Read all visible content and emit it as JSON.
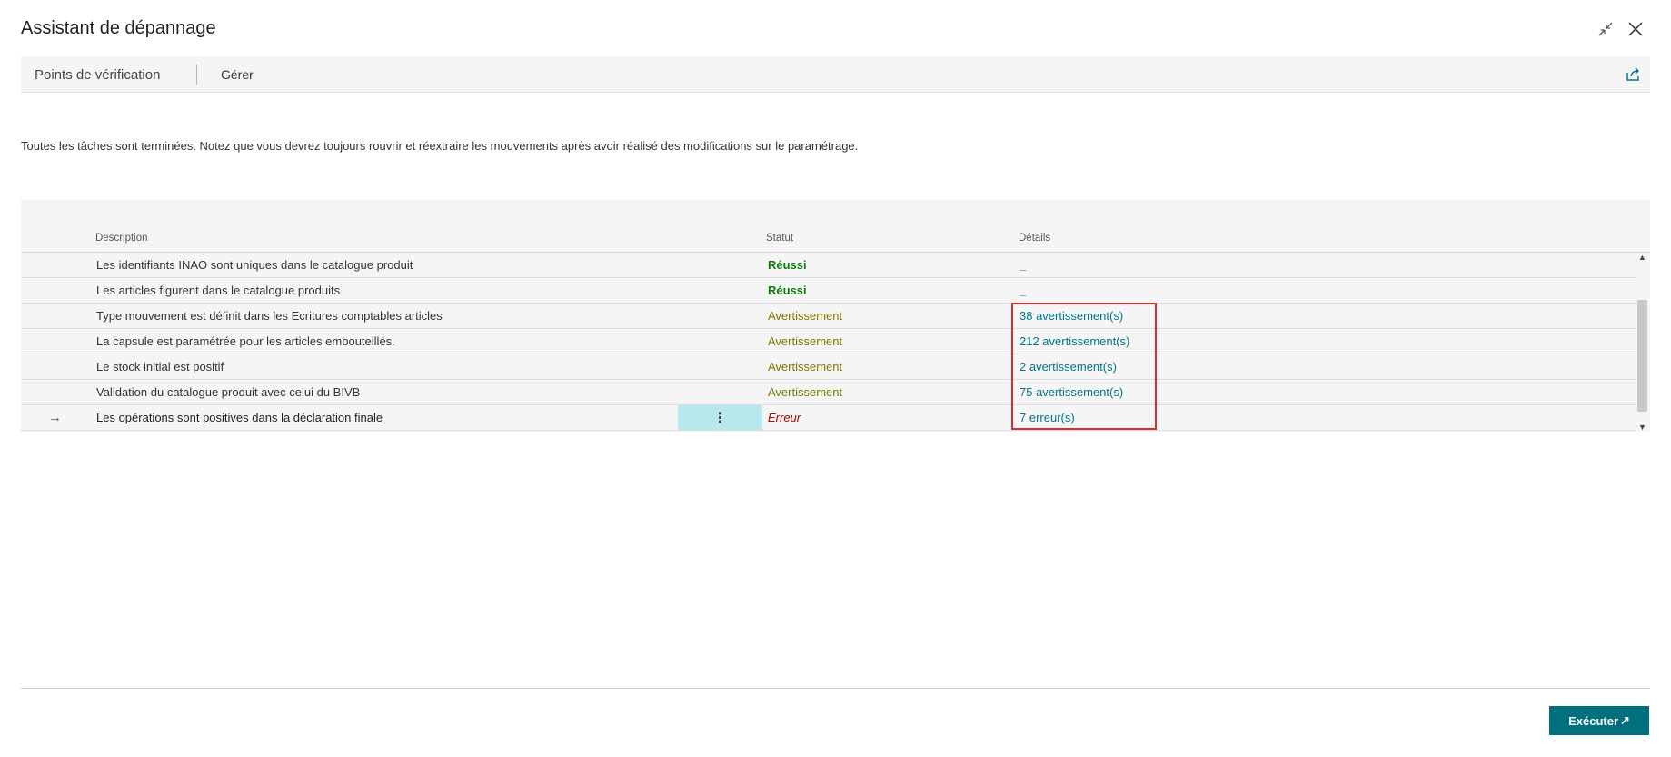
{
  "window": {
    "title": "Assistant de dépannage"
  },
  "actionbar": {
    "tabs": [
      {
        "label": "Points de vérification"
      },
      {
        "label": "Gérer"
      }
    ]
  },
  "info_text": "Toutes les tâches sont terminées. Notez que vous devrez toujours rouvrir et réextraire les mouvements après avoir réalisé des modifications sur le paramétrage.",
  "grid": {
    "columns": {
      "description": "Description",
      "status": "Statut",
      "details": "Détails"
    },
    "rows": [
      {
        "description": "Les identifiants INAO sont uniques dans le catalogue produit",
        "status": "Réussi",
        "details": "_"
      },
      {
        "description": "Les articles figurent dans le catalogue produits",
        "status": "Réussi",
        "details": "_"
      },
      {
        "description": "Type mouvement est définit dans les Ecritures comptables articles",
        "status": "Avertissement",
        "details": "38 avertissement(s)"
      },
      {
        "description": "La capsule est paramétrée pour les articles embouteillés.",
        "status": "Avertissement",
        "details": "212 avertissement(s)"
      },
      {
        "description": "Le stock initial est positif",
        "status": "Avertissement",
        "details": "2 avertissement(s)"
      },
      {
        "description": "Validation du catalogue produit avec celui du BIVB",
        "status": "Avertissement",
        "details": "75 avertissement(s)"
      },
      {
        "description": "Les opérations sont positives dans la déclaration finale",
        "status": "Erreur",
        "details": "7 erreur(s)"
      }
    ],
    "row_menu_glyph": "⋮",
    "row_arrow_glyph": "→",
    "status_colors": {
      "ok": "#107c10",
      "warning": "#7b7b00",
      "error": "#a80000"
    },
    "link_color": "#00778a"
  },
  "footer": {
    "run_label": "Exécuter",
    "run_icon": "↗",
    "accent": "#00707f"
  },
  "icons": {
    "collapse": "collapse-icon",
    "close": "close-icon",
    "share": "share-icon"
  }
}
